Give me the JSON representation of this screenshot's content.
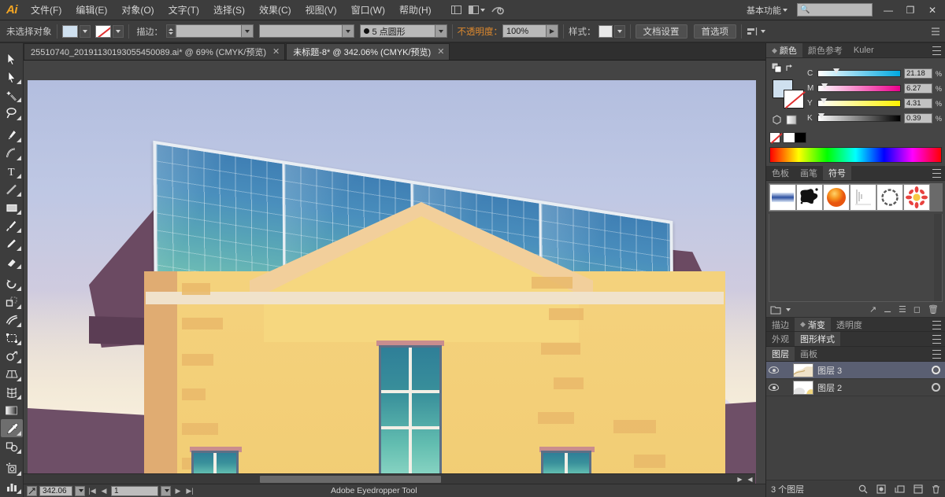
{
  "app": {
    "name": "Ai",
    "logo_color": "#f5a623"
  },
  "menubar": {
    "items": [
      "文件(F)",
      "编辑(E)",
      "对象(O)",
      "文字(T)",
      "选择(S)",
      "效果(C)",
      "视图(V)",
      "窗口(W)",
      "帮助(H)"
    ],
    "workspace": "基本功能",
    "search_placeholder": "",
    "search_value": "",
    "window_controls": {
      "minimize": "—",
      "restore": "❐",
      "close": "✕"
    },
    "icons": [
      "arrange-documents-icon",
      "screen-mode-icon",
      "go-to-bridge-icon"
    ]
  },
  "controlbar": {
    "selection_label": "未选择对象",
    "fill_color": "#cfe0ef",
    "stroke_color": "none",
    "stroke_label": "描边：",
    "stroke_weight": "",
    "stroke_profile": "",
    "brush_definition": "5 点圆形",
    "opacity_label": "不透明度：",
    "opacity_value": "100%",
    "style_label": "样式：",
    "document_setup": "文档设置",
    "preferences": "首选项"
  },
  "toolbar": {
    "tools": [
      {
        "name": "selection-tool",
        "label": "选择工具"
      },
      {
        "name": "direct-selection-tool",
        "label": "直接选择工具"
      },
      {
        "name": "magic-wand-tool",
        "label": "魔棒工具"
      },
      {
        "name": "lasso-tool",
        "label": "套索工具"
      },
      {
        "name": "pen-tool",
        "label": "钢笔工具"
      },
      {
        "name": "curvature-tool",
        "label": "曲率工具"
      },
      {
        "name": "type-tool",
        "label": "文字工具"
      },
      {
        "name": "line-segment-tool",
        "label": "直线段工具"
      },
      {
        "name": "rectangle-tool",
        "label": "矩形工具"
      },
      {
        "name": "paintbrush-tool",
        "label": "画笔工具"
      },
      {
        "name": "pencil-tool",
        "label": "铅笔工具"
      },
      {
        "name": "eraser-tool",
        "label": "橡皮擦工具"
      },
      {
        "name": "rotate-tool",
        "label": "旋转工具"
      },
      {
        "name": "scale-tool",
        "label": "比例缩放工具"
      },
      {
        "name": "width-tool",
        "label": "宽度工具"
      },
      {
        "name": "free-transform-tool",
        "label": "自由变换工具"
      },
      {
        "name": "shape-builder-tool",
        "label": "形状生成器工具"
      },
      {
        "name": "perspective-grid-tool",
        "label": "透视网格工具"
      },
      {
        "name": "mesh-tool",
        "label": "网格工具"
      },
      {
        "name": "gradient-tool",
        "label": "渐变工具"
      },
      {
        "name": "eyedropper-tool",
        "label": "吸管工具",
        "active": true
      },
      {
        "name": "blend-tool",
        "label": "混合工具"
      },
      {
        "name": "symbol-sprayer-tool",
        "label": "符号喷枪工具"
      },
      {
        "name": "column-graph-tool",
        "label": "柱形图工具"
      }
    ],
    "fill_color": "#cfe0ef",
    "stroke_color": "#ffffff"
  },
  "tabs": [
    {
      "title": "25510740_20191130193055450089.ai* @ 69% (CMYK/预览)",
      "active": false,
      "close": "✕"
    },
    {
      "title": "未标题-8* @ 342.06% (CMYK/预览)",
      "active": true,
      "close": "✕"
    }
  ],
  "statusbar": {
    "zoom_level": "342.06",
    "artboard_number": "1",
    "tool_name": "Adobe Eyedropper Tool",
    "nav_first": "|◀",
    "nav_prev": "◀",
    "nav_next": "▶",
    "nav_last": "▶|"
  },
  "color_panel": {
    "tabs": [
      {
        "label": "颜色",
        "active": true
      },
      {
        "label": "颜色参考",
        "active": false
      },
      {
        "label": "Kuler",
        "active": false
      }
    ],
    "mode": "CMYK",
    "channels": [
      {
        "label": "C",
        "value": "21.18",
        "unit": "%",
        "pos": 21.18,
        "track": "sl-c"
      },
      {
        "label": "M",
        "value": "6.27",
        "unit": "%",
        "pos": 6.27,
        "track": "sl-m"
      },
      {
        "label": "Y",
        "value": "4.31",
        "unit": "%",
        "pos": 4.31,
        "track": "sl-y"
      },
      {
        "label": "K",
        "value": "0.39",
        "unit": "%",
        "pos": 0.39,
        "track": "sl-k"
      }
    ],
    "fill_color": "#cfe0ef",
    "stroke_color": "none"
  },
  "symbols_panel": {
    "tabs": [
      {
        "label": "色板",
        "active": false
      },
      {
        "label": "画笔",
        "active": false
      },
      {
        "label": "符号",
        "active": true
      }
    ],
    "symbols": [
      "gradient-bar-symbol",
      "ink-splat-symbol",
      "orange-sphere-symbol",
      "thin-lines-symbol",
      "wreath-ring-symbol",
      "red-flower-symbol"
    ]
  },
  "stroke_group": {
    "tabs": [
      {
        "label": "描边",
        "active": false
      },
      {
        "label": "渐变",
        "active": true
      },
      {
        "label": "透明度",
        "active": false
      }
    ]
  },
  "appearance_group": {
    "tabs": [
      {
        "label": "外观",
        "active": false
      },
      {
        "label": "图形样式",
        "active": true
      }
    ]
  },
  "layers_panel": {
    "tabs": [
      {
        "label": "图层",
        "active": true
      },
      {
        "label": "画板",
        "active": false
      }
    ],
    "layers": [
      {
        "name": "图层 3",
        "selected": true,
        "visible": true,
        "locked": false
      },
      {
        "name": "图层 2",
        "selected": false,
        "visible": true,
        "locked": false
      }
    ],
    "footer_count": "3 个图层",
    "footer_icons": [
      "locate-object-icon",
      "make-clipping-mask-icon",
      "create-new-sublayer-icon",
      "create-new-layer-icon",
      "delete-selection-icon"
    ]
  },
  "artwork": {
    "description": "等距太阳能板房屋插画",
    "sky_top": "#b3bedf",
    "sky_bottom": "#f7efe0",
    "panel_top": "#3f7fb4",
    "panel_bottom": "#74c3b4",
    "roof_color": "#6b4a62",
    "wall_color": "#f3cf78",
    "ground_color": "#6e4f67",
    "window_top": "#2f7f98",
    "window_bottom": "#8fd8c6"
  }
}
